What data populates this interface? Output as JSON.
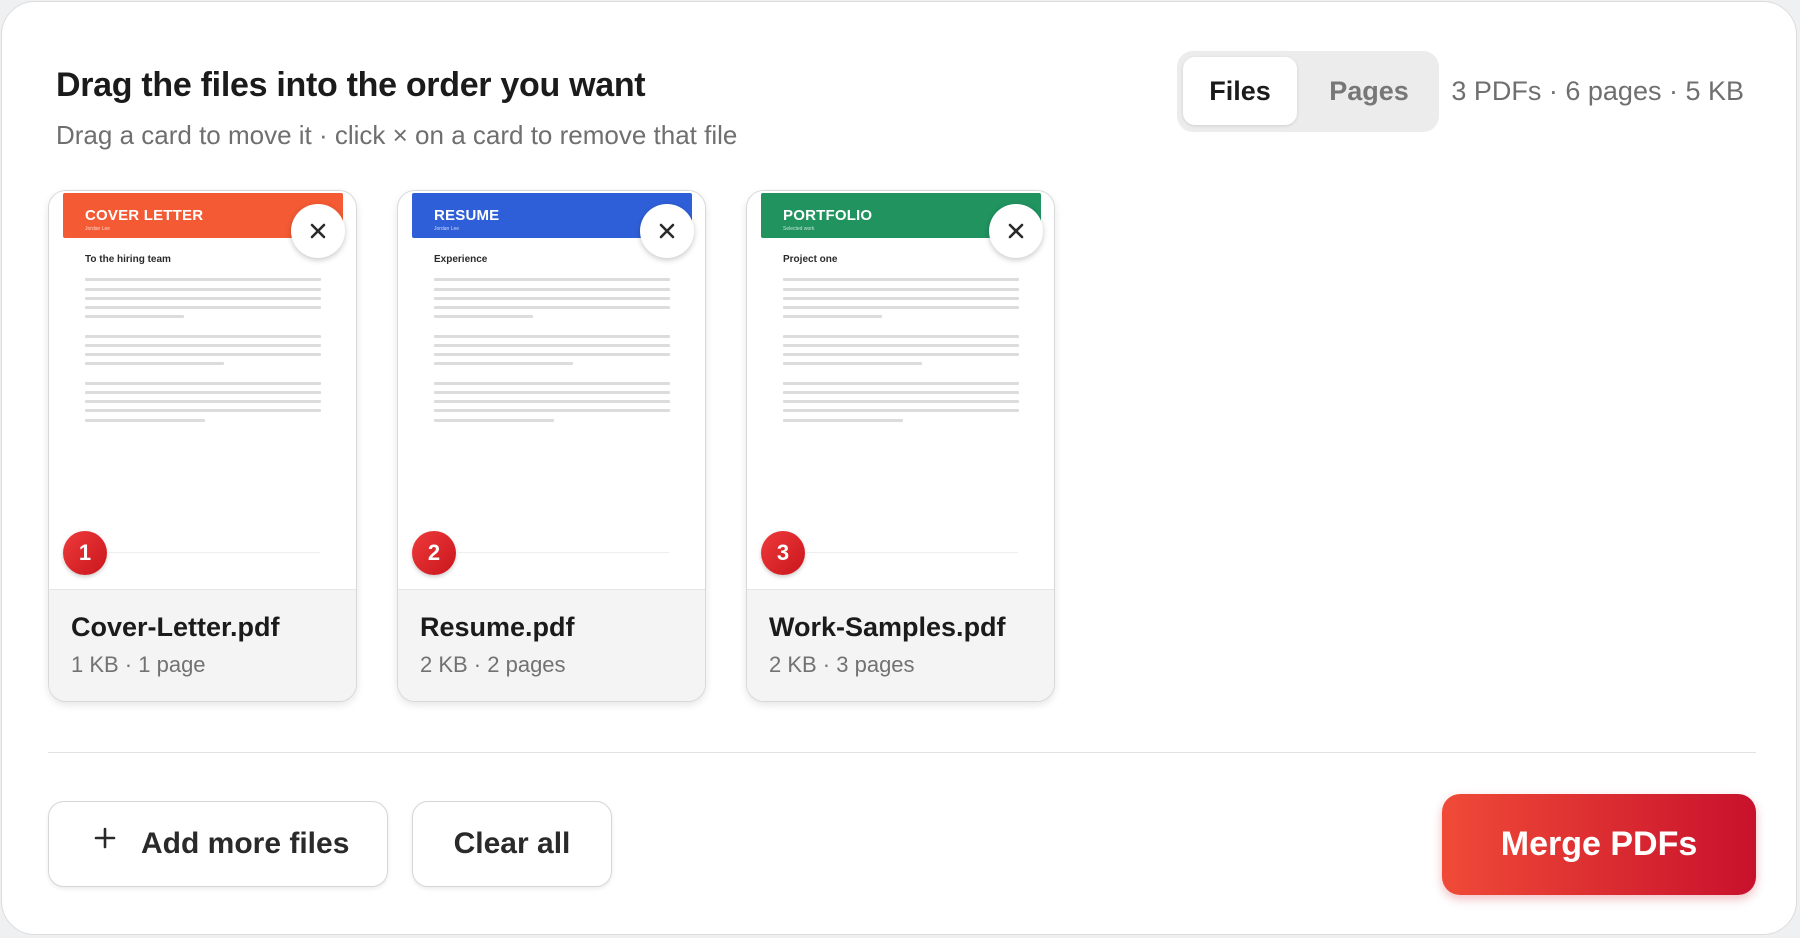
{
  "header": {
    "title": "Drag the files into the order you want",
    "subtitle": "Drag a card to move it · click × on a card to remove that file",
    "stats": "3 PDFs · 6 pages · 5 KB"
  },
  "view_toggle": {
    "options": [
      "Files",
      "Pages"
    ],
    "selected": "Files"
  },
  "files": [
    {
      "order": "1",
      "name": "Cover-Letter.pdf",
      "meta": "1 KB · 1 page",
      "preview_title": "COVER LETTER",
      "preview_subtitle": "Jordan Lee",
      "preview_heading": "To the hiring team",
      "accent": "#f45a33"
    },
    {
      "order": "2",
      "name": "Resume.pdf",
      "meta": "2 KB · 2 pages",
      "preview_title": "RESUME",
      "preview_subtitle": "Jordan Lee",
      "preview_heading": "Experience",
      "accent": "#2f5fd8"
    },
    {
      "order": "3",
      "name": "Work-Samples.pdf",
      "meta": "2 KB · 3 pages",
      "preview_title": "PORTFOLIO",
      "preview_subtitle": "Selected work",
      "preview_heading": "Project one",
      "accent": "#20935f"
    }
  ],
  "actions": {
    "add_more": "Add more files",
    "clear_all": "Clear all",
    "merge": "Merge PDFs"
  },
  "icons": {
    "remove": "close-icon",
    "add": "plus-icon"
  },
  "colors": {
    "merge_start": "#f04a37",
    "merge_end": "#c8112c",
    "badge": "#d8202a"
  }
}
